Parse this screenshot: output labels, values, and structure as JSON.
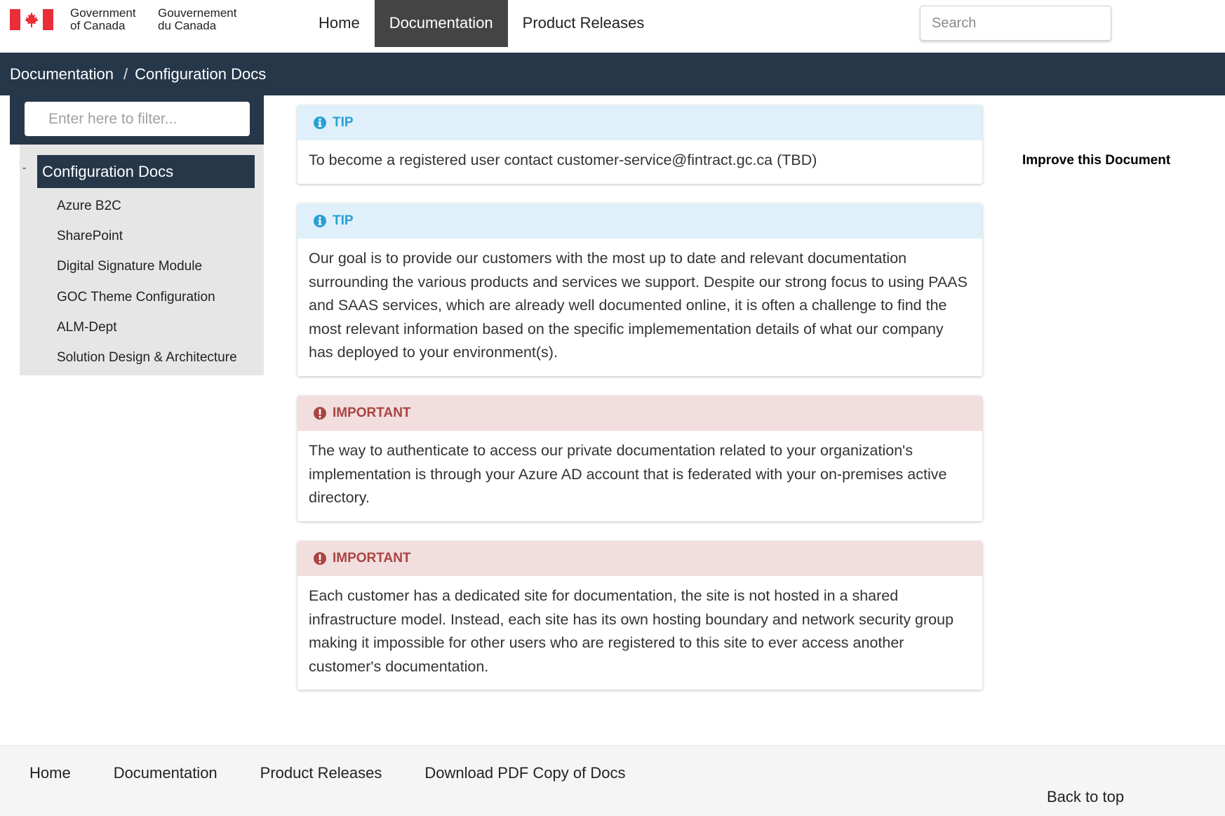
{
  "header": {
    "gov_en": [
      "Government",
      "of Canada"
    ],
    "gov_fr": [
      "Gouvernement",
      "du Canada"
    ],
    "nav": [
      {
        "label": "Home",
        "active": false
      },
      {
        "label": "Documentation",
        "active": true
      },
      {
        "label": "Product Releases",
        "active": false
      }
    ],
    "search_placeholder": "Search"
  },
  "breadcrumb": {
    "items": [
      "Documentation",
      "Configuration Docs"
    ],
    "separator": "/"
  },
  "sidebar": {
    "filter_placeholder": "Enter here to filter...",
    "collapse_symbol": "-",
    "section_title": "Configuration Docs",
    "items": [
      "Azure B2C",
      "SharePoint",
      "Digital Signature Module",
      "GOC Theme Configuration",
      "ALM-Dept",
      "Solution Design & Architecture"
    ]
  },
  "alerts": [
    {
      "type": "tip",
      "icon": "info-icon",
      "label": "TIP",
      "text": "To become a registered user contact customer-service@fintract.gc.ca (TBD)"
    },
    {
      "type": "tip",
      "icon": "info-icon",
      "label": "TIP",
      "text": "Our goal is to provide our customers with the most up to date and relevant documentation surrounding the various products and services we support. Despite our strong focus to using PAAS and SAAS services, which are already well documented online, it is often a challenge to find the most relevant information based on the specific implemementation details of what our company has deployed to your environment(s)."
    },
    {
      "type": "important",
      "icon": "exclamation-icon",
      "label": "IMPORTANT",
      "text": "The way to authenticate to access our private documentation related to your organization's implementation is through your Azure AD account that is federated with your on-premises active directory."
    },
    {
      "type": "important",
      "icon": "exclamation-icon",
      "label": "IMPORTANT",
      "text": "Each customer has a dedicated site for documentation, the site is not hosted in a shared infrastructure model. Instead, each site has its own hosting boundary and network security group making it impossible for other users who are registered to this site to ever access another customer's documentation."
    }
  ],
  "aside": {
    "improve_label": "Improve this Document"
  },
  "footer": {
    "nav": [
      "Home",
      "Documentation",
      "Product Releases",
      "Download PDF Copy of Docs"
    ],
    "back_to_top": "Back to top"
  },
  "colors": {
    "brand_dark": "#26374a",
    "nav_active": "#444444",
    "tip_bg": "#dff0fb",
    "tip_fg": "#2a9fd6",
    "important_bg": "#f2dede",
    "important_fg": "#a94442",
    "flag_red": "#eb2d37"
  }
}
